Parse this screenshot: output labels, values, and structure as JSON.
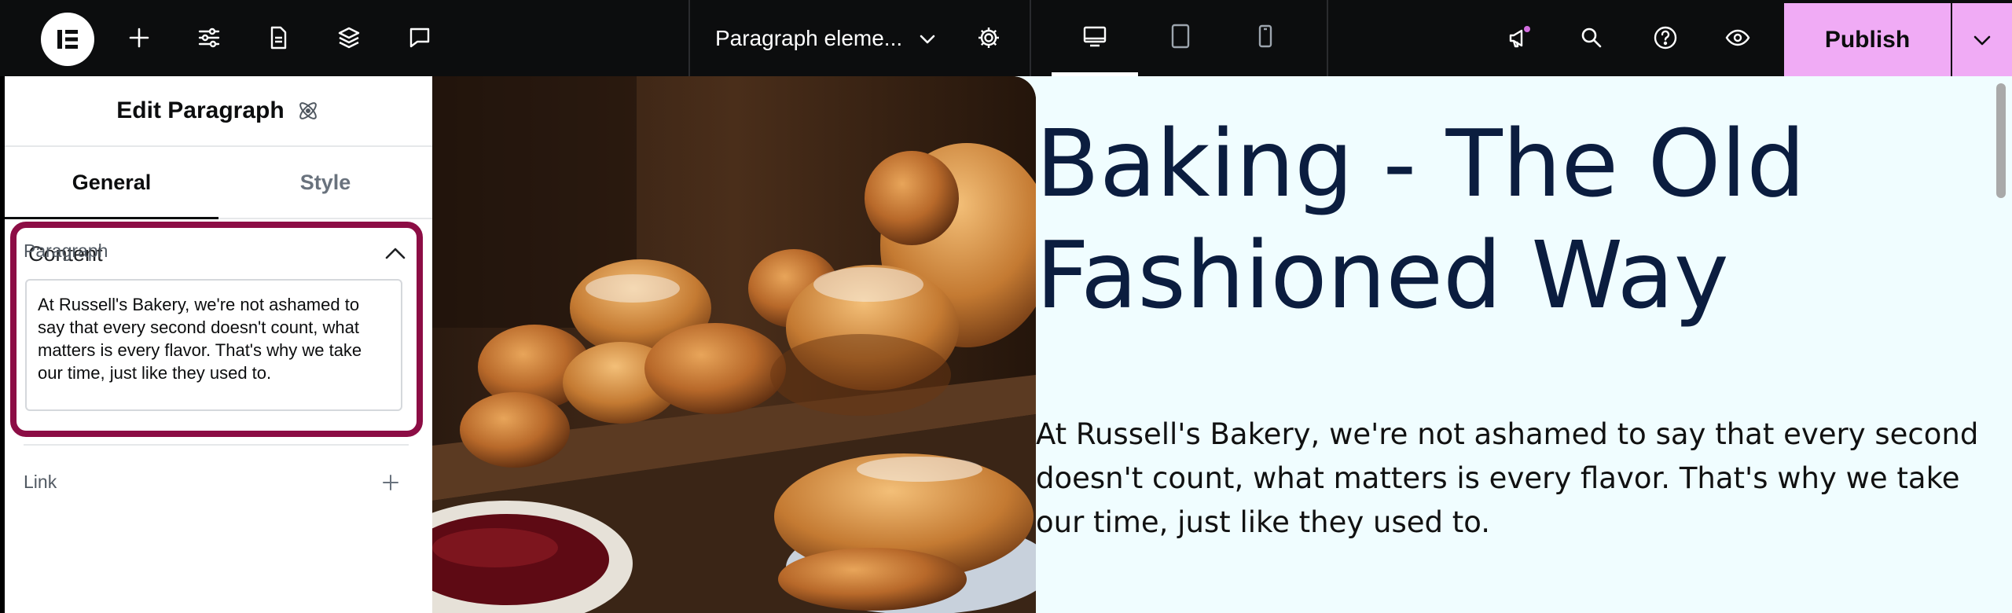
{
  "topbar": {
    "document_title": "Paragraph eleme...",
    "publish_label": "Publish",
    "icons": [
      "add-icon",
      "sliders-icon",
      "page-icon",
      "layers-icon",
      "comments-icon"
    ],
    "notification_dot_color": "#d36ee0",
    "publish_color": "#f0abf5"
  },
  "panel": {
    "title": "Edit Paragraph",
    "tabs": [
      {
        "label": "General",
        "active": true
      },
      {
        "label": "Style",
        "active": false
      }
    ],
    "section_content": "Content",
    "paragraph_label": "Paragraph",
    "paragraph_value": "At Russell's Bakery, we're not ashamed to say that every second doesn't count, what matters is every flavor. That's why we take our time, just like they used to.",
    "link_label": "Link",
    "highlight_color": "#8c0d45"
  },
  "canvas": {
    "heading": "Baking - The Old Fashioned Way",
    "body": "At Russell's Bakery, we're not ashamed to say that every second doesn't count, what matters is every flavor. That's why we take our time, just like they used to.",
    "background_color": "#f0fdff",
    "heading_color": "#0b1d3f"
  }
}
